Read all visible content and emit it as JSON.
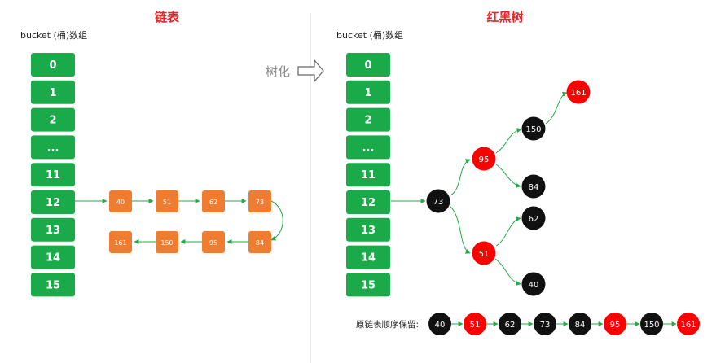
{
  "left_panel": {
    "title": "链表",
    "subtitle": "bucket (桶)数组"
  },
  "right_panel": {
    "title": "红黑树",
    "subtitle": "bucket (桶)数组"
  },
  "bucket_labels": [
    "0",
    "1",
    "2",
    "...",
    "11",
    "12",
    "13",
    "14",
    "15"
  ],
  "transform_label": "树化",
  "linked_list": {
    "row1": [
      "40",
      "51",
      "62",
      "73"
    ],
    "row2": [
      "161",
      "150",
      "95",
      "84"
    ]
  },
  "tree": {
    "root": "73",
    "n95": "95",
    "n51": "51",
    "n150": "150",
    "n84": "84",
    "n62": "62",
    "n40": "40",
    "n161": "161"
  },
  "order": {
    "label": "原链表顺序保留:",
    "nodes": [
      {
        "v": "40",
        "c": "black"
      },
      {
        "v": "51",
        "c": "red"
      },
      {
        "v": "62",
        "c": "black"
      },
      {
        "v": "73",
        "c": "black"
      },
      {
        "v": "84",
        "c": "black"
      },
      {
        "v": "95",
        "c": "red"
      },
      {
        "v": "150",
        "c": "black"
      },
      {
        "v": "161",
        "c": "red"
      }
    ]
  },
  "colors": {
    "title_red": "#e8262a",
    "bucket_green": "#1aaa4a",
    "list_orange": "#ee7d31",
    "node_red": "#ff0000",
    "node_black": "#111111",
    "arrow_green": "#22aa44"
  }
}
